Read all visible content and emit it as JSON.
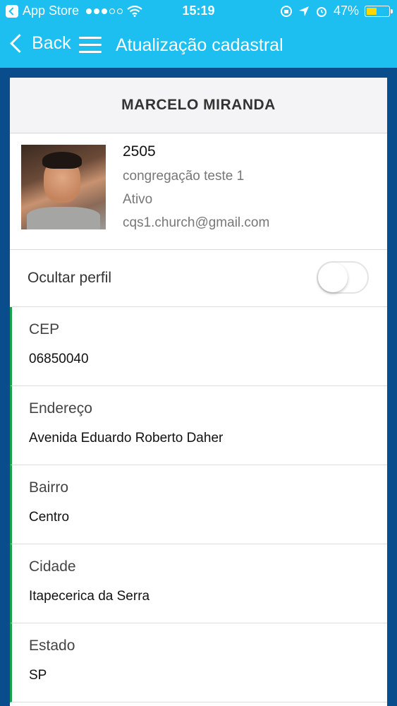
{
  "status_bar": {
    "carrier": "App Store",
    "time": "15:19",
    "battery_percent": "47%",
    "battery_level": 0.47,
    "icons": [
      "back-to-app-icon",
      "wifi-icon",
      "rotation-lock-icon",
      "location-icon",
      "alarm-icon",
      "battery-icon"
    ]
  },
  "nav": {
    "back_label": "Back",
    "title": "Atualização cadastral"
  },
  "profile": {
    "name": "MARCELO MIRANDA",
    "id": "2505",
    "congregation": "congregação teste 1",
    "status": "Ativo",
    "email": "cqs1.church@gmail.com"
  },
  "hide_profile": {
    "label": "Ocultar perfil",
    "enabled": false
  },
  "fields": [
    {
      "label": "CEP",
      "value": "06850040"
    },
    {
      "label": "Endereço",
      "value": "Avenida Eduardo Roberto Daher"
    },
    {
      "label": "Bairro",
      "value": "Centro"
    },
    {
      "label": "Cidade",
      "value": "Itapecerica da Serra"
    },
    {
      "label": "Estado",
      "value": "SP"
    }
  ],
  "colors": {
    "nav_bar": "#1dbef0",
    "page_background": "#0a4d8c",
    "field_accent": "#1aa14a",
    "battery": "#ffd700"
  }
}
